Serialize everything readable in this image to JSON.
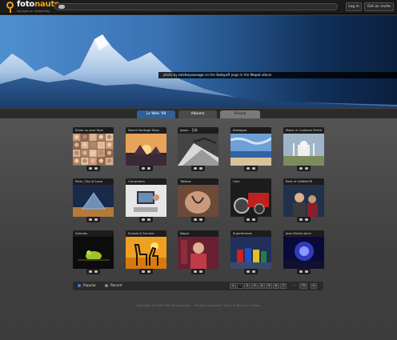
{
  "brand": {
    "name_a": "foto",
    "name_b": "nauts",
    "tagline": "Voyages for Imaginality"
  },
  "header": {
    "login": "Log in",
    "invite": "Get an invite"
  },
  "hero": {
    "c1": "photo by ",
    "user": "mickeysavage",
    "c2": " on the ",
    "page": "Gobyofi",
    "c3": " page in the ",
    "album": "Nepal",
    "c4": " album"
  },
  "tabs": [
    "Le Web '08",
    "Albums",
    "People"
  ],
  "albums": [
    {
      "title": "Show us your face",
      "scene": "faces"
    },
    {
      "title": "World Heritage Sites",
      "scene": "sunset"
    },
    {
      "title": "Japan - 日本",
      "scene": "japan"
    },
    {
      "title": "Bretagne",
      "scene": "beach"
    },
    {
      "title": "Stack in Customs Perith",
      "scene": "tajmahal"
    },
    {
      "title": "Paris, City of Love",
      "scene": "louvre"
    },
    {
      "title": "Computers",
      "scene": "computer"
    },
    {
      "title": "Tattoos",
      "scene": "tattoo"
    },
    {
      "title": "Cars",
      "scene": "cars"
    },
    {
      "title": "Best of LeWeb'08",
      "scene": "leweb"
    },
    {
      "title": "Animals",
      "scene": "animal"
    },
    {
      "title": "Sunset & Sunrise",
      "scene": "giraffe"
    },
    {
      "title": "Nepal",
      "scene": "nepal"
    },
    {
      "title": "Superheroes",
      "scene": "lego"
    },
    {
      "title": "Jean Michel Jarre",
      "scene": "jarre"
    }
  ],
  "pager": {
    "popular": "Popular",
    "recent": "Recent",
    "pages": [
      "<",
      "1",
      "2",
      "3",
      "4",
      "5",
      "6",
      "7",
      "...",
      "77",
      ">"
    ]
  },
  "footer": "Copyright © 2008-2009 fotonauts Inc. · All rights reserved · Terms of Service · Privacy",
  "colors": {
    "accent": "#f3a21c",
    "tab_active": "#2f5f98",
    "link": "#7fb8e6",
    "popular_dot": "#3f7fc4"
  }
}
